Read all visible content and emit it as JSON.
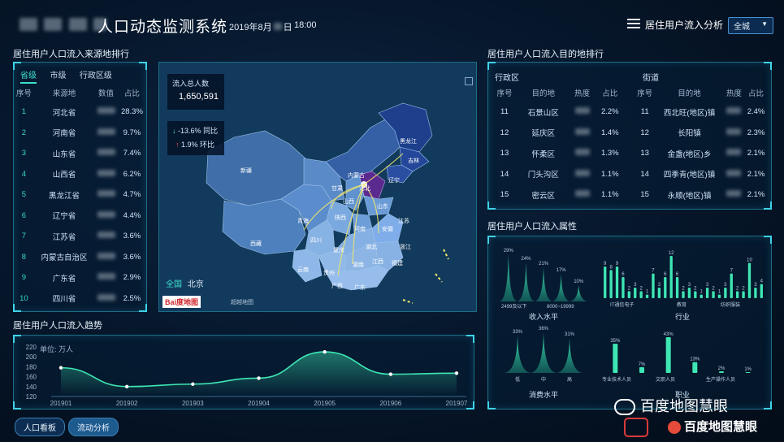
{
  "header": {
    "title": "人口动态监测系统",
    "datetime": "2019年8月",
    "day_suffix": "日",
    "time": "18:00",
    "menu_title": "居住用户流入分析",
    "region_select": "全城"
  },
  "source_rank": {
    "title": "居住用户人口流入来源地排行",
    "tabs": [
      "省级",
      "市级",
      "行政区级"
    ],
    "columns": [
      "序号",
      "来源地",
      "数值",
      "占比"
    ],
    "rows": [
      {
        "seq": "1",
        "name": "河北省",
        "pct": "28.3%"
      },
      {
        "seq": "2",
        "name": "河南省",
        "pct": "9.7%"
      },
      {
        "seq": "3",
        "name": "山东省",
        "pct": "7.4%"
      },
      {
        "seq": "4",
        "name": "山西省",
        "pct": "6.2%"
      },
      {
        "seq": "5",
        "name": "黑龙江省",
        "pct": "4.7%"
      },
      {
        "seq": "6",
        "name": "辽宁省",
        "pct": "4.4%"
      },
      {
        "seq": "7",
        "name": "江苏省",
        "pct": "3.6%"
      },
      {
        "seq": "8",
        "name": "内蒙古自治区",
        "pct": "3.6%"
      },
      {
        "seq": "9",
        "name": "广东省",
        "pct": "2.9%"
      },
      {
        "seq": "10",
        "name": "四川省",
        "pct": "2.5%"
      }
    ]
  },
  "map": {
    "total_label": "流入总人数",
    "total_value": "1,650,591",
    "yoy_value": "-13.6%",
    "yoy_label": "同比",
    "mom_value": "1.9%",
    "mom_label": "环比",
    "labels": [
      "新疆",
      "西藏",
      "青海",
      "甘肃",
      "内蒙古",
      "黑龙江",
      "吉林",
      "辽宁",
      "河北",
      "山西",
      "山东",
      "河南",
      "陕西",
      "四川",
      "重庆",
      "湖北",
      "安徽",
      "江苏",
      "贵州",
      "湖南",
      "江西",
      "福建",
      "广西",
      "广东",
      "云南",
      "浙江"
    ],
    "scope_all": "全国",
    "scope_city": "北京",
    "logo": "Bai度地图",
    "copyright": "超越地图"
  },
  "trend": {
    "title": "居住用户人口流入趋势",
    "unit": "单位: 万人",
    "chart_data": {
      "type": "line",
      "categories": [
        "201901",
        "201902",
        "201903",
        "201904",
        "201905",
        "201906",
        "201907"
      ],
      "values": [
        178,
        140,
        145,
        157,
        210,
        165,
        167
      ],
      "ylim": [
        120,
        220
      ],
      "yticks": [
        120,
        140,
        160,
        180,
        200,
        220
      ],
      "color": "#3ee6b4"
    }
  },
  "dest_rank": {
    "title": "居住用户人口流入目的地排行",
    "left_title": "行政区",
    "right_title": "街道",
    "columns": [
      "序号",
      "目的地",
      "热度",
      "占比"
    ],
    "left_rows": [
      {
        "seq": "11",
        "name": "石景山区",
        "pct": "2.2%"
      },
      {
        "seq": "12",
        "name": "延庆区",
        "pct": "1.4%"
      },
      {
        "seq": "13",
        "name": "怀柔区",
        "pct": "1.3%"
      },
      {
        "seq": "14",
        "name": "门头沟区",
        "pct": "1.1%"
      },
      {
        "seq": "15",
        "name": "密云区",
        "pct": "1.1%"
      }
    ],
    "right_rows": [
      {
        "seq": "11",
        "name": "西北旺(地区)镇",
        "pct": "2.4%"
      },
      {
        "seq": "12",
        "name": "长阳镇",
        "pct": "2.3%"
      },
      {
        "seq": "13",
        "name": "金盏(地区)乡",
        "pct": "2.1%"
      },
      {
        "seq": "14",
        "name": "四季青(地区)镇",
        "pct": "2.1%"
      },
      {
        "seq": "15",
        "name": "永顺(地区)镇",
        "pct": "2.1%"
      }
    ]
  },
  "attrs": {
    "title": "居住用户人口流入属性",
    "income": {
      "label": "收入水平",
      "chart_data": {
        "type": "area",
        "values": [
          29,
          24,
          21,
          17,
          10
        ],
        "labels": [
          "29%",
          "24%",
          "21%",
          "17%",
          "10%"
        ],
        "tick_left": "2499及以下",
        "tick_right": "8000~19999"
      }
    },
    "industry": {
      "label": "行业",
      "chart_data": {
        "type": "bar",
        "values": [
          9,
          8,
          9,
          6,
          2,
          3,
          2,
          1,
          7,
          3,
          6,
          12,
          6,
          2,
          3,
          2,
          1,
          3,
          2,
          1,
          3,
          7,
          2,
          2,
          10,
          3,
          4
        ],
        "ticks": [
          "IT通信电子",
          "教育",
          "纺织服装"
        ]
      }
    },
    "consume": {
      "label": "消费水平",
      "chart_data": {
        "type": "area",
        "values": [
          33,
          36,
          31
        ],
        "labels": [
          "33%",
          "36%",
          "31%"
        ],
        "ticks": [
          "低",
          "中",
          "高"
        ]
      }
    },
    "job": {
      "label": "职业",
      "chart_data": {
        "type": "bar",
        "values": [
          35,
          7,
          43,
          13,
          2,
          1
        ],
        "labels": [
          "35%",
          "7%",
          "43%",
          "13%",
          "2%",
          "1%"
        ],
        "ticks": [
          "专业技术人员",
          "文职人员",
          "生产操作人员"
        ]
      }
    }
  },
  "footer": {
    "btn1": "人口看板",
    "btn2": "流动分析",
    "watermark1": "百度地图慧眼",
    "watermark2": "百度地图慧眼"
  }
}
